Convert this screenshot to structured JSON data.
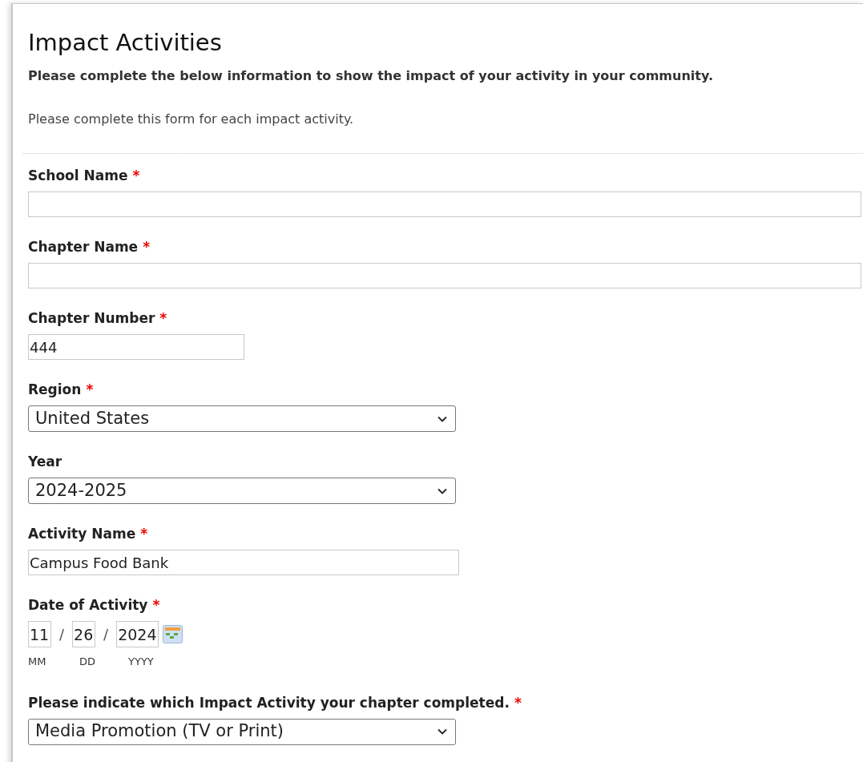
{
  "title": "Impact Activities",
  "intro": "Please complete the below information to show the impact of your activity in your community.",
  "note": "Please complete this form for each impact activity.",
  "required_mark": "*",
  "fields": [
    {
      "kind": "text",
      "label": "School Name",
      "required": true
    },
    {
      "kind": "text",
      "label": "Chapter Name",
      "required": true
    },
    {
      "kind": "text",
      "label": "Chapter Number",
      "required": true,
      "value": "444"
    },
    {
      "kind": "select",
      "label": "Region",
      "required": true,
      "value": "United States"
    },
    {
      "kind": "select",
      "label": "Year",
      "required": false,
      "value": "2024-2025"
    },
    {
      "kind": "text",
      "label": "Activity Name",
      "required": true,
      "value": "Campus Food Bank"
    },
    {
      "kind": "date",
      "label": "Date of Activity",
      "required": true,
      "separator": "/",
      "parts": [
        {
          "value": "11",
          "caption": "MM"
        },
        {
          "value": "26",
          "caption": "DD"
        },
        {
          "value": "2024",
          "caption": "YYYY"
        }
      ]
    },
    {
      "kind": "select",
      "label": "Please indicate which Impact Activity your chapter completed.",
      "required": true,
      "value": "Media Promotion (TV or Print)"
    }
  ]
}
